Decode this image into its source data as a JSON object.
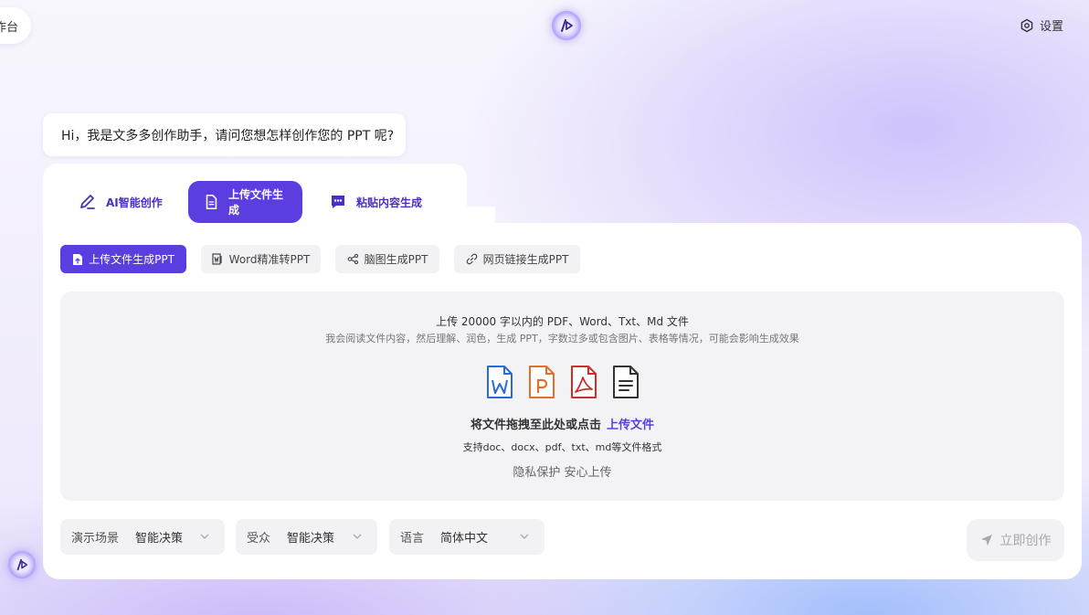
{
  "header": {
    "workbench_label": "作台",
    "settings_label": "设置"
  },
  "greeting": "Hi，我是文多多创作助手，请问您想怎样创作您的 PPT 呢?",
  "mode_tabs": [
    {
      "label": "AI智能创作",
      "icon": "pen-icon",
      "active": false
    },
    {
      "label": "上传文件生成",
      "icon": "document-icon",
      "active": true
    },
    {
      "label": "粘贴内容生成",
      "icon": "chat-icon",
      "active": false
    }
  ],
  "sub_tabs": [
    {
      "label": "上传文件生成PPT",
      "icon": "file-upload-icon",
      "active": true
    },
    {
      "label": "Word精准转PPT",
      "icon": "word-convert-icon",
      "active": false
    },
    {
      "label": "脑图生成PPT",
      "icon": "mindmap-icon",
      "active": false
    },
    {
      "label": "网页链接生成PPT",
      "icon": "link-icon",
      "active": false
    }
  ],
  "upload": {
    "limit_text": "上传 20000 字以内的 PDF、Word、Txt、Md 文件",
    "desc_text": "我会阅读文件内容，然后理解、润色，生成 PPT，字数过多或包含图片、表格等情况，可能会影响生成效果",
    "file_types": [
      {
        "name": "word-file-icon",
        "letter": "W",
        "color": "#2b6bd6"
      },
      {
        "name": "ppt-file-icon",
        "letter": "P",
        "color": "#e0702c"
      },
      {
        "name": "pdf-file-icon",
        "letter": "",
        "color": "#c9302c"
      },
      {
        "name": "txt-file-icon",
        "letter": "",
        "color": "#333333"
      }
    ],
    "drag_text": "将文件拖拽至此处或点击",
    "upload_link": "上传文件",
    "formats_text": "支持doc、docx、pdf、txt、md等文件格式",
    "privacy_text": "隐私保护 安心上传"
  },
  "selects": {
    "scene": {
      "label": "演示场景",
      "value": "智能决策"
    },
    "audience": {
      "label": "受众",
      "value": "智能决策"
    },
    "language": {
      "label": "语言",
      "value": "简体中文"
    }
  },
  "create_button": "立即创作"
}
